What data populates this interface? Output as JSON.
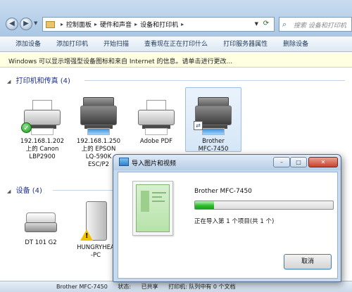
{
  "address": {
    "crumbs": [
      "控制面板",
      "硬件和声音",
      "设备和打印机"
    ],
    "search_placeholder": "搜索 设备和打印机"
  },
  "toolbar": {
    "items": [
      "添加设备",
      "添加打印机",
      "开始扫描",
      "查看现在正在打印什么",
      "打印服务器属性",
      "删除设备"
    ]
  },
  "infobar": {
    "text": "Windows 可以显示增强型设备图标和来自 Internet 的信息。请单击进行更改..."
  },
  "printers_group": {
    "title": "打印机和传真 (4)",
    "devices": [
      {
        "line1": "192.168.1.202",
        "line2": "上的 Canon",
        "line3": "LBP2900",
        "icon": "printer-icon",
        "badge": "default-check-icon"
      },
      {
        "line1": "192.168.1.250",
        "line2": "上的 EPSON",
        "line3": "LQ-590K",
        "line4": "ESC/P2",
        "icon": "printer-icon"
      },
      {
        "line1": "Adobe PDF",
        "icon": "printer-icon"
      },
      {
        "line1": "Brother",
        "line2": "MFC-7450",
        "icon": "multifunction-printer-icon",
        "badge": "share-icon"
      }
    ]
  },
  "devices_group": {
    "title": "设备 (4)",
    "devices": [
      {
        "line1": "DT 101 G2",
        "icon": "usb-drive-icon"
      },
      {
        "line1": "HUNGRYHEA",
        "line2": "-PC",
        "icon": "hard-drive-icon",
        "badge": "warning-icon"
      }
    ]
  },
  "statusbar": {
    "name": "Brother MFC-7450",
    "state_prefix": "状态:",
    "state": "已共享",
    "category": "打印机: 队列中有 0 个文档"
  },
  "dialog": {
    "title": "导入图片和视频",
    "device": "Brother MFC-7450",
    "progress": 0.14,
    "status": "正在导入第 1 个项目(共 1 个)",
    "cancel_label": "取消",
    "close_label": "✕",
    "min_label": "–",
    "max_label": "□"
  },
  "colors": {
    "group_header": "#1e3287",
    "progress_green": "#2fbf2f",
    "info_bg": "#ffffe1"
  }
}
